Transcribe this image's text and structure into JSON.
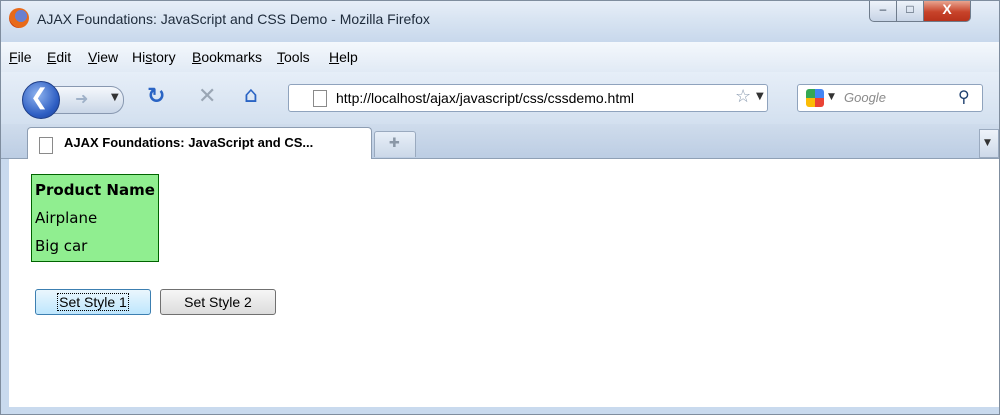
{
  "window": {
    "title": "AJAX Foundations: JavaScript and CSS Demo - Mozilla Firefox",
    "controls": {
      "minimize": "‒",
      "maximize": "□",
      "close": "X"
    }
  },
  "menu": [
    {
      "label": "File"
    },
    {
      "label": "Edit"
    },
    {
      "label": "View"
    },
    {
      "label": "History"
    },
    {
      "label": "Bookmarks"
    },
    {
      "label": "Tools"
    },
    {
      "label": "Help"
    }
  ],
  "navbar": {
    "url": "http://localhost/ajax/javascript/css/cssdemo.html",
    "search_placeholder": "Google"
  },
  "tabs": [
    {
      "label": "AJAX Foundations: JavaScript and CS..."
    }
  ],
  "page": {
    "table": {
      "header": "Product Name",
      "rows": [
        "Airplane",
        "Big car"
      ],
      "background": "#90ee90",
      "border": "#006400"
    },
    "buttons": [
      {
        "label": "Set Style 1"
      },
      {
        "label": "Set Style 2"
      }
    ]
  },
  "icons": [
    "firefox-logo-icon",
    "back-arrow-icon",
    "forward-arrow-icon",
    "reload-icon",
    "stop-icon",
    "home-icon",
    "page-icon",
    "bookmark-star-icon",
    "google-icon",
    "search-magnifier-icon",
    "new-tab-icon"
  ]
}
